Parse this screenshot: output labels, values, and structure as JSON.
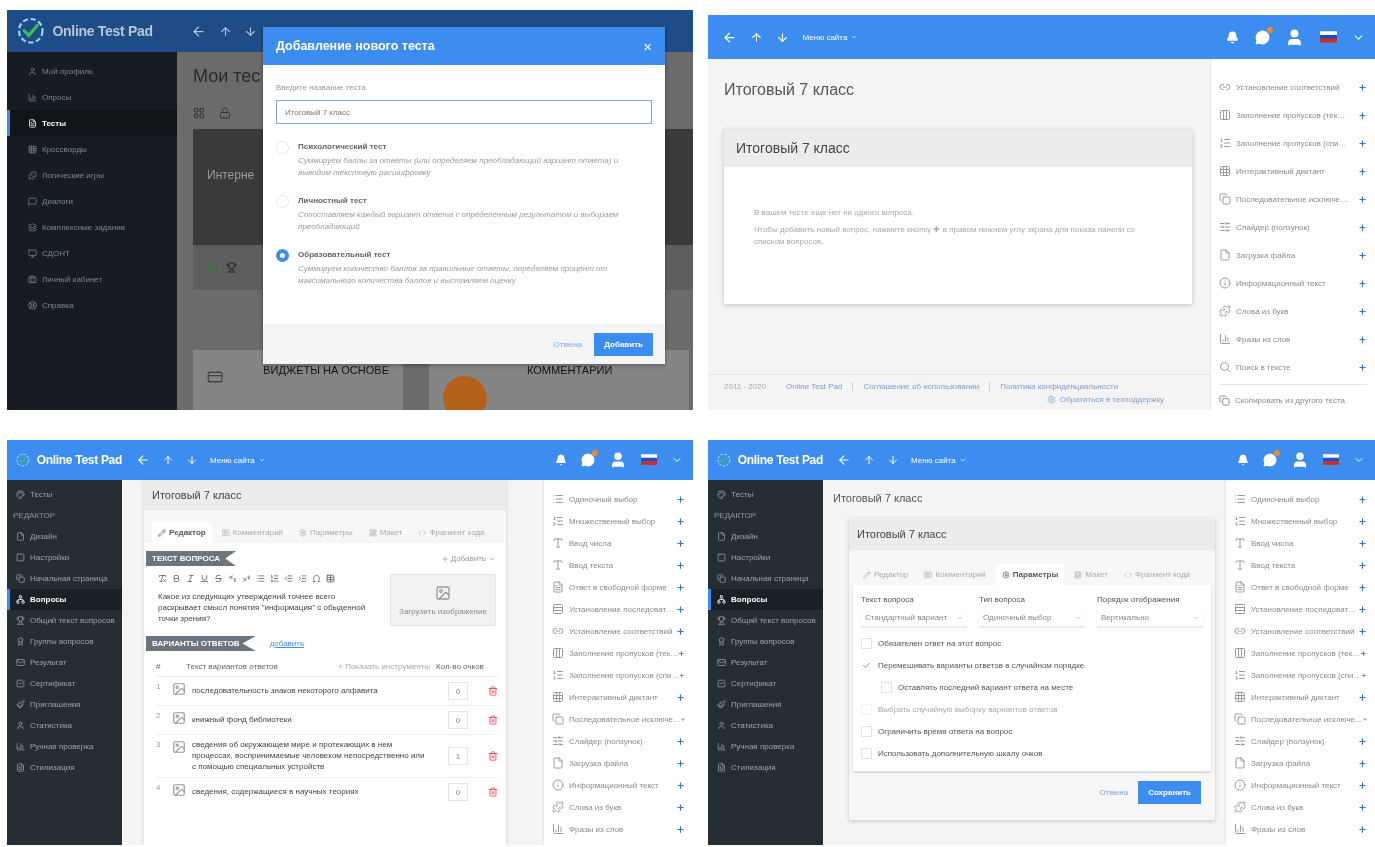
{
  "screens": [
    {
      "kind": "new_test_dialog",
      "topbar": {
        "brand": "Online Test Pad"
      },
      "sidebar": [
        {
          "kind": "item",
          "label": "Мой профиль",
          "selected": false
        },
        {
          "kind": "item",
          "label": "Опросы",
          "selected": false
        },
        {
          "kind": "item",
          "label": "Тесты",
          "selected": true
        },
        {
          "kind": "item",
          "label": "Кроссворды",
          "selected": false
        },
        {
          "kind": "item",
          "label": "Логические игры",
          "selected": false
        },
        {
          "kind": "item",
          "label": "Диалоги",
          "selected": false
        },
        {
          "kind": "item",
          "label": "Комплексные задания",
          "selected": false
        },
        {
          "kind": "item",
          "label": "СДОНТ",
          "selected": false
        },
        {
          "kind": "item",
          "label": "Личный кабинет",
          "selected": false
        },
        {
          "kind": "item",
          "label": "Справка",
          "selected": false
        }
      ],
      "page_title": "Мои тес",
      "card_title": "Интерне",
      "widgets": [
        "ВИДЖЕТЫ НА ОСНОВЕ",
        "КОММЕНТАРИИ"
      ],
      "dialog": {
        "title": "Добавление нового теста",
        "close": "×",
        "field_label": "Введите название теста",
        "value": "Итоговый 7 класс",
        "options": [
          {
            "title": "Психологический тест",
            "description": "Суммируем баллы за ответы (или определяем преобладающий вариант ответа) и выводим текстовую расшифровку",
            "selected": false
          },
          {
            "title": "Личностный тест",
            "description": "Сопоставляем каждый вариант ответа с определенным результатом и выбираем преобладающий",
            "selected": false
          },
          {
            "title": "Образовательный тест",
            "description": "Суммируем количество баллов за правильные ответы, определяем процент от максимального количества баллов и выставляем оценку",
            "selected": true
          }
        ],
        "buttons": [
          {
            "label": "Отмена",
            "kind": "link"
          },
          {
            "label": "Добавить",
            "kind": "primary"
          }
        ]
      }
    },
    {
      "kind": "empty_test",
      "topbar": {
        "menu_label": "Меню сайта"
      },
      "title": "Итоговый 7 класс",
      "card_title": "Итоговый 7 класс",
      "empty_lines": [
        "В вашем тесте еще нет ни одного вопроса.",
        "Чтобы добавить новый вопрос, нажмите кнопку ✚ в правом нижнем углу экрана для показа панели со списком вопросов."
      ],
      "question_types": [
        "Установление соответствий",
        "Заполнение пропусков (тек…",
        "Заполнение пропусков (спи…",
        "Интерактивный диктант",
        "Последовательное исключе…",
        "Слайдер (ползунок)",
        "Загрузка файла",
        "Информационный текст",
        "Слова из букв",
        "Фразы из слов",
        "Поиск в тексте"
      ],
      "copy_link": "Скопировать из другого теста",
      "footer": {
        "years": "2011 - 2020",
        "links": [
          "Online Test Pad",
          "Соглашение об использовании",
          "Политика конфиденциальности"
        ],
        "support": "Обратиться в техподдержку"
      }
    },
    {
      "kind": "question_editor",
      "topbar": {
        "brand": "Online Test Pad",
        "menu_label": "Меню сайта"
      },
      "sidebar": [
        {
          "kind": "item",
          "label": "Тесты",
          "selected": false
        },
        {
          "kind": "section",
          "label": "РЕДАКТОР"
        },
        {
          "kind": "item",
          "label": "Дизайн",
          "selected": false
        },
        {
          "kind": "item",
          "label": "Настройки",
          "selected": false
        },
        {
          "kind": "item",
          "label": "Начальная страница",
          "selected": false
        },
        {
          "kind": "item",
          "label": "Вопросы",
          "selected": true
        },
        {
          "kind": "item",
          "label": "Общий текст вопросов",
          "selected": false
        },
        {
          "kind": "item",
          "label": "Группы вопросов",
          "selected": false
        },
        {
          "kind": "item",
          "label": "Результат",
          "selected": false
        },
        {
          "kind": "item",
          "label": "Сертификат",
          "selected": false
        },
        {
          "kind": "item",
          "label": "Приглашения",
          "selected": false
        },
        {
          "kind": "item",
          "label": "Статистика",
          "selected": false
        },
        {
          "kind": "item",
          "label": "Ручная проверка",
          "selected": false
        },
        {
          "kind": "item",
          "label": "Стилизация",
          "selected": false
        }
      ],
      "title": "Итоговый 7 класс",
      "tabs": [
        {
          "label": "Редактор",
          "selected": true
        },
        {
          "label": "Комментарий",
          "selected": false
        },
        {
          "label": "Параметры",
          "selected": false
        },
        {
          "label": "Макет",
          "selected": false
        },
        {
          "label": "Фрагмент кода",
          "selected": false
        }
      ],
      "question_label": "ТЕКСТ ВОПРОСА",
      "add_menu": "Добавить",
      "question_text": "Какое из следующих утверждений точнее всего раскрывает смысл понятия \"информация\" с обыденной точки зрения?",
      "image_hint": "Загрузить изображение",
      "answers_label": "ВАРИАНТЫ ОТВЕТОВ",
      "add_link": "добавить",
      "columns": [
        "#",
        "Текст вариантов ответов",
        "+ Показать инструменты",
        "Кол-во очков"
      ],
      "answers": [
        {
          "number": "1",
          "text": "последовательность знаков некоторого алфавита",
          "score": "0"
        },
        {
          "number": "2",
          "text": "книжный фонд библиотеки",
          "score": "0"
        },
        {
          "number": "3",
          "text": "сведения об окружающем мире и протекающих в нем процессах, воспринимаемые человеком непосредственно или с помощью специальных устройств",
          "score": "1"
        },
        {
          "number": "4",
          "text": "сведения, содержащиеся в научных теориях",
          "score": "0"
        }
      ],
      "question_types": [
        "Одиночный выбор",
        "Множественный выбор",
        "Ввод числа",
        "Ввод текста",
        "Ответ в свободной форме",
        "Установление последоват…",
        "Установление соответствий",
        "Заполнение пропусков (тек…",
        "Заполнение пропусков (спи…",
        "Интерактивный диктант",
        "Последовательное исключе…",
        "Слайдер (ползунок)",
        "Загрузка файла",
        "Информационный текст",
        "Слова из букв",
        "Фразы из слов"
      ]
    },
    {
      "kind": "question_params",
      "topbar": {
        "brand": "Online Test Pad",
        "menu_label": "Меню сайта"
      },
      "sidebar": [
        {
          "kind": "item",
          "label": "Тесты",
          "selected": false
        },
        {
          "kind": "section",
          "label": "РЕДАКТОР"
        },
        {
          "kind": "item",
          "label": "Дизайн",
          "selected": false
        },
        {
          "kind": "item",
          "label": "Настройки",
          "selected": false
        },
        {
          "kind": "item",
          "label": "Начальная страница",
          "selected": false
        },
        {
          "kind": "item",
          "label": "Вопросы",
          "selected": true
        },
        {
          "kind": "item",
          "label": "Общий текст вопросов",
          "selected": false
        },
        {
          "kind": "item",
          "label": "Группы вопросов",
          "selected": false
        },
        {
          "kind": "item",
          "label": "Результат",
          "selected": false
        },
        {
          "kind": "item",
          "label": "Сертификат",
          "selected": false
        },
        {
          "kind": "item",
          "label": "Приглашения",
          "selected": false
        },
        {
          "kind": "item",
          "label": "Статистика",
          "selected": false
        },
        {
          "kind": "item",
          "label": "Ручная проверка",
          "selected": false
        },
        {
          "kind": "item",
          "label": "Стилизация",
          "selected": false
        }
      ],
      "title": "Итоговый 7 класс",
      "card_title": "Итоговый 7 класс",
      "tabs": [
        {
          "label": "Редактор",
          "selected": false
        },
        {
          "label": "Комментарий",
          "selected": false
        },
        {
          "label": "Параметры",
          "selected": true
        },
        {
          "label": "Макет",
          "selected": false
        },
        {
          "label": "Фрагмент кода",
          "selected": false
        }
      ],
      "selects": [
        {
          "label": "Текст вопроса",
          "value": "Стандартный вариант"
        },
        {
          "label": "Тип вопроса",
          "value": "Одиночный выбор"
        },
        {
          "label": "Порядок отображения",
          "value": "Вертикально"
        }
      ],
      "options": [
        {
          "label": "Обязателен ответ на этот вопрос",
          "checked": false,
          "disabled": false
        },
        {
          "label": "Перемешивать варианты ответов в случайном порядке",
          "checked": true,
          "disabled": false,
          "children": [
            {
              "label": "Оставлять последний вариант ответа на месте",
              "checked": false,
              "disabled": false
            }
          ]
        },
        {
          "label": "Выбрать случайную выборку вариантов ответов",
          "checked": false,
          "disabled": true
        },
        {
          "label": "Ограничить время ответа на вопрос",
          "checked": false,
          "disabled": false
        },
        {
          "label": "Использовать дополнительную шкалу очков",
          "checked": false,
          "disabled": false
        }
      ],
      "buttons": [
        {
          "label": "Отмена",
          "kind": "link"
        },
        {
          "label": "Сохранить",
          "kind": "primary"
        }
      ],
      "question_types": [
        "Одиночный выбор",
        "Множественный выбор",
        "Ввод числа",
        "Ввод текста",
        "Ответ в свободной форме",
        "Установление последоват…",
        "Установление соответствий",
        "Заполнение пропусков (тек…",
        "Заполнение пропусков (спи…",
        "Интерактивный диктант",
        "Последовательное исключе…",
        "Слайдер (ползунок)",
        "Загрузка файла",
        "Информационный текст",
        "Слова из букв",
        "Фразы из слов"
      ]
    }
  ]
}
